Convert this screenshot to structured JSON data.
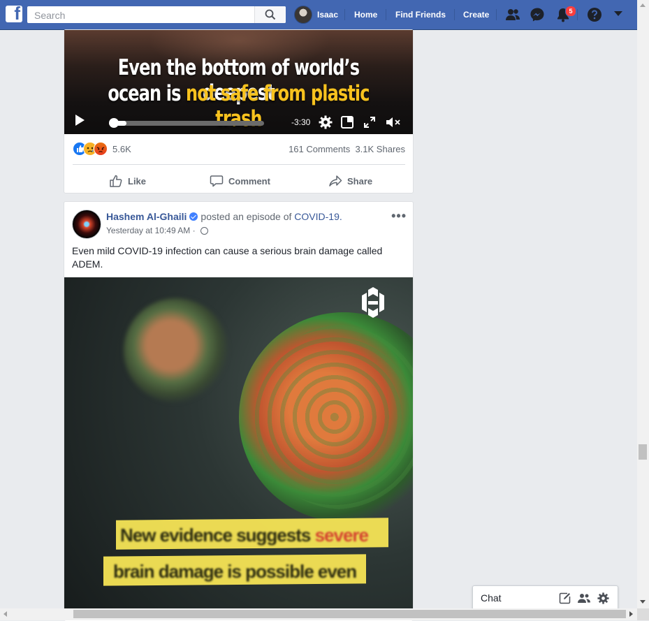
{
  "topbar": {
    "search_placeholder": "Search",
    "user_name": "Isaac",
    "nav": [
      "Home",
      "Find Friends",
      "Create"
    ],
    "notification_count": "5"
  },
  "post1": {
    "caption_line1": "Even the bottom of world’s deepest",
    "caption_line2_prefix": "ocean is ",
    "caption_line2_highlight": "not safe from plastic trash",
    "time_remaining": "-3:30",
    "progress": 0.02,
    "reaction_count": "5.6K",
    "comments": "161 Comments",
    "shares": "3.1K Shares",
    "actions": {
      "like": "Like",
      "comment": "Comment",
      "share": "Share"
    }
  },
  "post2": {
    "author": "Hashem Al-Ghaili",
    "verb": "posted an episode of",
    "series": "COVID-19.",
    "time": "Yesterday at 10:49 AM",
    "dot": "·",
    "more": "•••",
    "text": "Even mild COVID-19 infection can cause a serious brain damage called ADEM.",
    "subtitle_line1": "New evidence suggests ",
    "subtitle_line1_red": "severe",
    "subtitle_line2": "brain damage is possible even"
  },
  "chat": {
    "label": "Chat"
  },
  "colors": {
    "brand": "#4267b2",
    "link": "#385898",
    "highlight": "#f7c21e"
  }
}
